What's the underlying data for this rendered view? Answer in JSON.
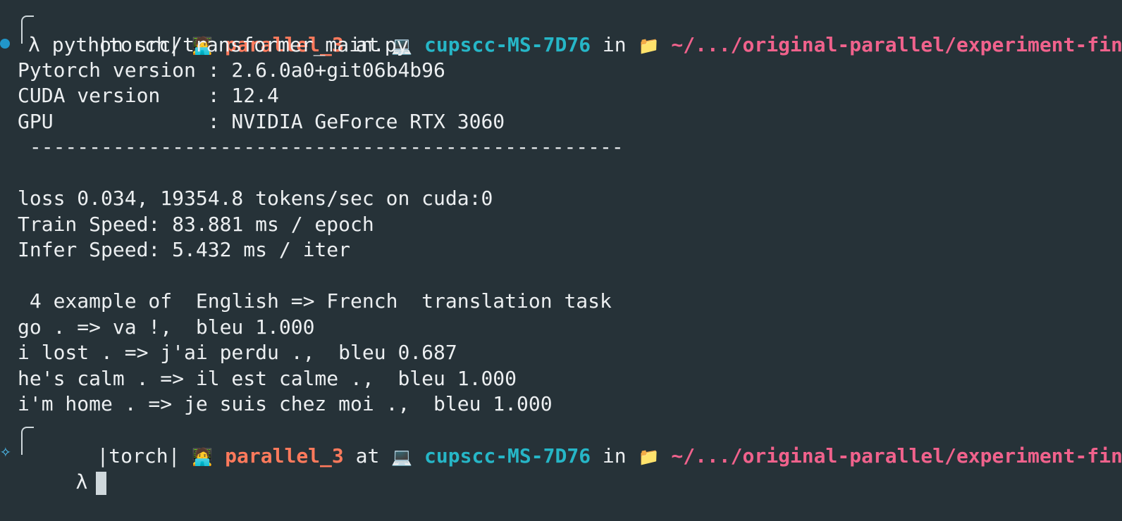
{
  "prompt": {
    "env": "|torch|",
    "user": "parallel_3",
    "at": "at",
    "host": "cupscc-MS-7D76",
    "in": "in",
    "path": "~/.../original-parallel/experiment-final",
    "user_icon": "person-technologist-icon",
    "host_icon": "laptop-icon",
    "folder_icon": "folder-icon"
  },
  "command": "λ python src/transformer_main.py",
  "output_lines": [
    "Pytorch version : 2.6.0a0+git06b4b96",
    "CUDA version    : 12.4",
    "GPU             : NVIDIA GeForce RTX 3060",
    " --------------------------------------------------",
    "",
    "loss 0.034, 19354.8 tokens/sec on cuda:0",
    "Train Speed: 83.881 ms / epoch",
    "Infer Speed: 5.432 ms / iter",
    "",
    " 4 example of  English => French  translation task",
    "go . => va !,  bleu 1.000",
    "i lost . => j'ai perdu .,  bleu 0.687",
    "he's calm . => il est calme .,  bleu 1.000",
    "i'm home . => je suis chez moi .,  bleu 1.000"
  ],
  "final_prompt_lambda": "λ",
  "colors": {
    "background": "#263238",
    "user": "#ff7a5c",
    "host": "#26b6c7",
    "path": "#f0628c"
  }
}
